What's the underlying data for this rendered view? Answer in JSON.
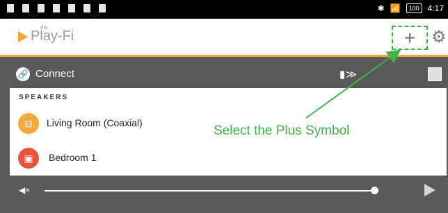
{
  "statusbar": {
    "left_icons": [
      "usb-icon",
      "image-icon",
      "wifi-icon",
      "warning-icon",
      "lightbulb-icon",
      "usb-debug-icon",
      "sim-icon"
    ],
    "right": {
      "bluetooth": "✱",
      "signal": "📶",
      "battery": "100",
      "time": "4:17"
    }
  },
  "header": {
    "logo_small": "dts",
    "logo_text": "Play-Fi",
    "plus_label": "+",
    "settings_icon": "⚙"
  },
  "panel": {
    "connect_label": "Connect",
    "section_label": "SPEAKERS",
    "speakers": [
      {
        "name": "Living Room (Coaxial)",
        "icon_color": "#f4a73b",
        "glyph": "⊟"
      },
      {
        "name": "Bedroom 1",
        "icon_color": "#e8533a",
        "glyph": "▣▣"
      }
    ]
  },
  "playbar": {
    "volume": 0.97
  },
  "annotation": {
    "text": "Select the Plus Symbol",
    "color": "#3eb34a"
  }
}
